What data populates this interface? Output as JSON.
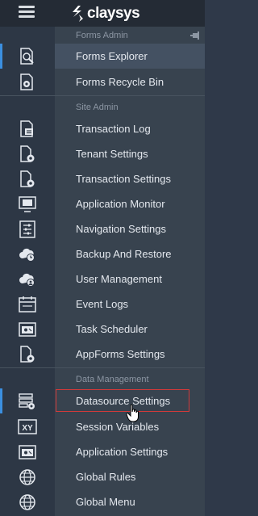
{
  "brand": {
    "name": "claysys"
  },
  "sections": {
    "forms_admin": "Forms Admin",
    "site_admin": "Site Admin",
    "data_management": "Data Management"
  },
  "items": [
    {
      "label": "Forms Explorer",
      "icon": "search-doc-icon"
    },
    {
      "label": "Forms Recycle Bin",
      "icon": "recycle-doc-icon"
    },
    {
      "label": "Transaction Log",
      "icon": "log-doc-icon"
    },
    {
      "label": "Tenant Settings",
      "icon": "doc-gear-icon"
    },
    {
      "label": "Transaction Settings",
      "icon": "doc-gear-icon"
    },
    {
      "label": "Application Monitor",
      "icon": "monitor-icon"
    },
    {
      "label": "Navigation Settings",
      "icon": "sliders-icon"
    },
    {
      "label": "Backup And Restore",
      "icon": "cloud-clock-icon"
    },
    {
      "label": "User Management",
      "icon": "cloud-user-icon"
    },
    {
      "label": "Event Logs",
      "icon": "calendar-icon"
    },
    {
      "label": "Task Scheduler",
      "icon": "scheduler-icon"
    },
    {
      "label": "AppForms Settings",
      "icon": "doc-gear-icon"
    },
    {
      "label": "Datasource Settings",
      "icon": "datasource-icon"
    },
    {
      "label": "Session Variables",
      "icon": "xy-icon"
    },
    {
      "label": "Application Settings",
      "icon": "app-settings-icon"
    },
    {
      "label": "Global Rules",
      "icon": "globe-icon"
    },
    {
      "label": "Global Menu",
      "icon": "globe-icon"
    }
  ]
}
